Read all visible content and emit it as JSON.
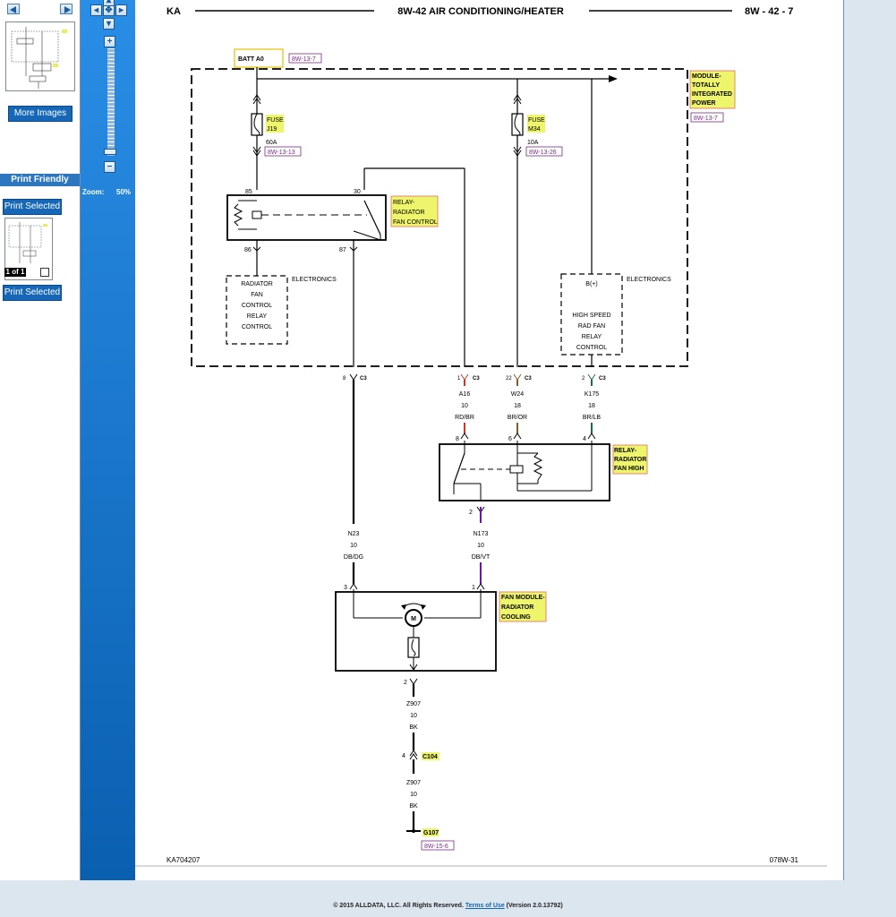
{
  "sidebar": {
    "more_images_label": "More Images",
    "print_friendly_label": "Print Friendly",
    "print_selected_label": "Print Selected",
    "page_counter": "1 of 1"
  },
  "zoom": {
    "label": "Zoom:",
    "value": "50%"
  },
  "diagram": {
    "header_left": "KA",
    "header_title": "8W-42 AIR CONDITIONING/HEATER",
    "header_right": "8W - 42 - 7",
    "footer_left": "KA704207",
    "footer_right": "078W-31",
    "batt_label": "BATT A0",
    "batt_ref": "8W-13-7",
    "module_label": [
      "MODULE-",
      "TOTALLY",
      "INTEGRATED",
      "POWER"
    ],
    "module_ref": "8W-13-7",
    "fuse1_label": [
      "FUSE",
      "J19"
    ],
    "fuse1_rating": "60A",
    "fuse1_ref": "8W-13-13",
    "fuse2_label": [
      "FUSE",
      "M34"
    ],
    "fuse2_rating": "10A",
    "fuse2_ref": "8W-13-26",
    "relay1_label": [
      "RELAY-",
      "RADIATOR",
      "FAN CONTROL"
    ],
    "relay1_pins": [
      "85",
      "30",
      "86",
      "87"
    ],
    "electronics_label": "ELECTRONICS",
    "rfc_box": [
      "RADIATOR",
      "FAN",
      "CONTROL",
      "RELAY",
      "CONTROL"
    ],
    "bplus_label": "B(+)",
    "hs_box": [
      "HIGH SPEED",
      "RAD FAN",
      "RELAY",
      "CONTROL"
    ],
    "c3_pins": [
      "8",
      "1",
      "22",
      "2"
    ],
    "c3_label": "C3",
    "wires": [
      {
        "circuit": "A16",
        "gauge": "10",
        "color": "RD/BR"
      },
      {
        "circuit": "W24",
        "gauge": "18",
        "color": "BR/OR"
      },
      {
        "circuit": "K175",
        "gauge": "18",
        "color": "BR/LB"
      }
    ],
    "relay2_pins": [
      "8",
      "6",
      "4",
      "2"
    ],
    "relay2_label": [
      "RELAY-",
      "RADIATOR",
      "FAN HIGH"
    ],
    "wire_n23": {
      "circuit": "N23",
      "gauge": "10",
      "color": "DB/DG"
    },
    "wire_n173": {
      "circuit": "N173",
      "gauge": "10",
      "color": "DB/VT"
    },
    "fan_pins": [
      "3",
      "1"
    ],
    "fan_label": [
      "FAN MODULE-",
      "RADIATOR",
      "COOLING"
    ],
    "motor_letter": "M",
    "fan_ground_pin": "2",
    "wire_z907_1": {
      "circuit": "Z907",
      "gauge": "10",
      "color": "BK"
    },
    "c104_pin": "4",
    "c104_label": "C104",
    "wire_z907_2": {
      "circuit": "Z907",
      "gauge": "10",
      "color": "BK"
    },
    "ground_label": "G107",
    "ground_ref": "8W-15-6"
  },
  "footer": {
    "copyright": "© 2015 ALLDATA, LLC. All Rights Reserved.",
    "terms_link": "Terms of Use",
    "version": "(Version 2.0.13792)"
  },
  "colors": {
    "highlight_yellow": "#eef56a",
    "ref_purple": "#7a2a8a",
    "wire_red": "#c0392b",
    "wire_brown": "#8a5a2b",
    "wire_green": "#1e6b4a",
    "wire_purple": "#6a1b9a",
    "panel_blue": "#1667b8"
  }
}
